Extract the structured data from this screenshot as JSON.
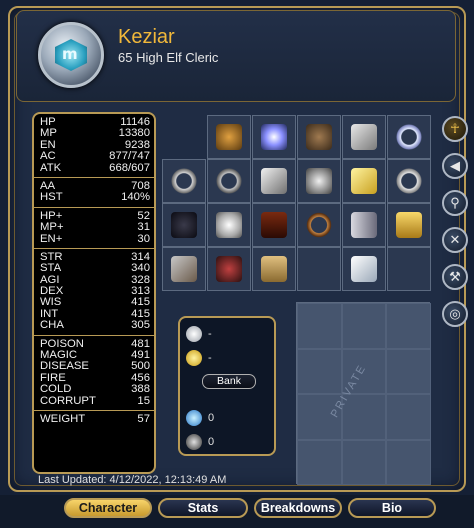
{
  "character": {
    "name": "Keziar",
    "subtitle": "65 High Elf Cleric",
    "avatar_glyph": "m"
  },
  "stats": {
    "groups": [
      [
        [
          "HP",
          "11146"
        ],
        [
          "MP",
          "13380"
        ],
        [
          "EN",
          "9238"
        ],
        [
          "AC",
          "877/747"
        ],
        [
          "ATK",
          "668/607"
        ]
      ],
      [
        [
          "AA",
          "708"
        ],
        [
          "HST",
          "140%"
        ]
      ],
      [
        [
          "HP+",
          "52"
        ],
        [
          "MP+",
          "31"
        ],
        [
          "EN+",
          "30"
        ]
      ],
      [
        [
          "STR",
          "314"
        ],
        [
          "STA",
          "340"
        ],
        [
          "AGI",
          "328"
        ],
        [
          "DEX",
          "313"
        ],
        [
          "WIS",
          "415"
        ],
        [
          "INT",
          "415"
        ],
        [
          "CHA",
          "305"
        ]
      ],
      [
        [
          "POISON",
          "481"
        ],
        [
          "MAGIC",
          "491"
        ],
        [
          "DISEASE",
          "500"
        ],
        [
          "FIRE",
          "456"
        ],
        [
          "COLD",
          "388"
        ],
        [
          "CORRUPT",
          "15"
        ]
      ],
      [
        [
          "WEIGHT",
          "57"
        ]
      ]
    ]
  },
  "last_updated": "Last Updated: 4/12/2022, 12:13:49 AM",
  "equipment_icons": [
    "",
    "ear-hook-icon",
    "glowing-orb-icon",
    "helmet-icon",
    "sword-hilt-icon",
    "silver-ring-icon",
    "chain-bracelet-icon",
    "shackle-icon",
    "gauntlet-icon",
    "plate-armor-icon",
    "golden-bar-icon",
    "ring-icon",
    "dark-cloak-icon",
    "round-shield-icon",
    "red-cloak-icon",
    "amulet-chain-icon",
    "greaves-icon",
    "boots-icon",
    "staff-icon",
    "charm-icon",
    "book-icon",
    "",
    "crystal-shard-icon",
    ""
  ],
  "currency": {
    "silver": "-",
    "gold": "-",
    "bank_label": "Bank",
    "blue_coin": "0",
    "dark_coin": "0"
  },
  "private_label": "PRIVATE",
  "side_buttons": [
    "character-icon",
    "arrow-icon",
    "magnify-icon",
    "swords-icon",
    "crossed-tools-icon",
    "ring-icon"
  ],
  "tabs": {
    "character": "Character",
    "stats": "Stats",
    "breakdowns": "Breakdowns",
    "bio": "Bio"
  }
}
